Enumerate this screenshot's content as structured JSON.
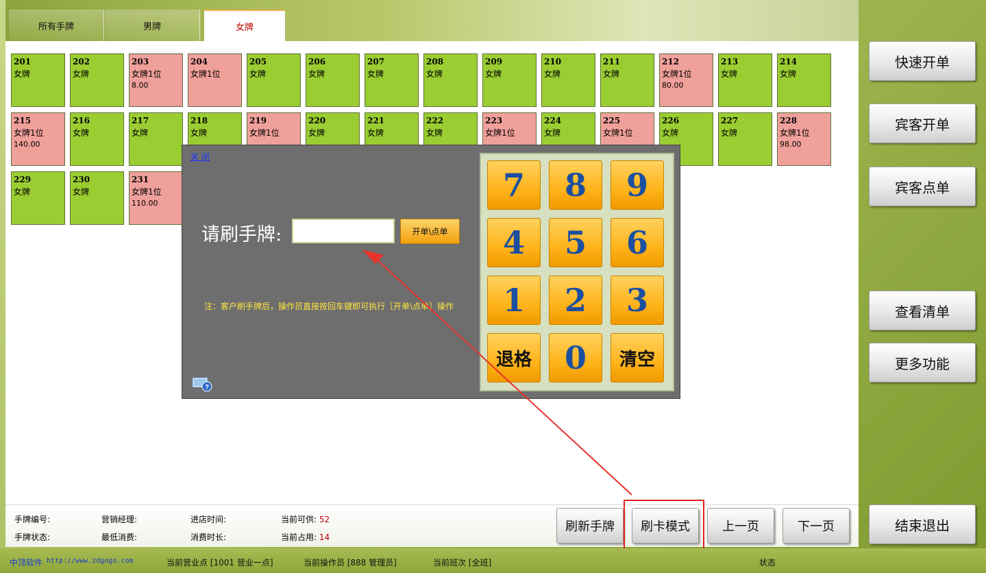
{
  "tabs": [
    {
      "label": "所有手牌",
      "active": false
    },
    {
      "label": "男牌",
      "active": false
    },
    {
      "label": "女牌",
      "active": true
    }
  ],
  "cards": [
    {
      "num": "201",
      "type": "女牌",
      "status": "free"
    },
    {
      "num": "202",
      "type": "女牌",
      "status": "free"
    },
    {
      "num": "203",
      "type": "女牌",
      "status": "used",
      "guests": "1位",
      "amount": "8.00"
    },
    {
      "num": "204",
      "type": "女牌",
      "status": "used",
      "guests": "1位"
    },
    {
      "num": "205",
      "type": "女牌",
      "status": "free"
    },
    {
      "num": "206",
      "type": "女牌",
      "status": "free"
    },
    {
      "num": "207",
      "type": "女牌",
      "status": "free"
    },
    {
      "num": "208",
      "type": "女牌",
      "status": "free"
    },
    {
      "num": "209",
      "type": "女牌",
      "status": "free"
    },
    {
      "num": "210",
      "type": "女牌",
      "status": "free"
    },
    {
      "num": "211",
      "type": "女牌",
      "status": "free"
    },
    {
      "num": "212",
      "type": "女牌",
      "status": "used",
      "guests": "1位",
      "amount": "80.00"
    },
    {
      "num": "213",
      "type": "女牌",
      "status": "free"
    },
    {
      "num": "214",
      "type": "女牌",
      "status": "free"
    },
    {
      "num": "215",
      "type": "女牌",
      "status": "used",
      "guests": "1位",
      "amount": "140.00"
    },
    {
      "num": "216",
      "type": "女牌",
      "status": "free"
    },
    {
      "num": "217",
      "type": "女牌",
      "status": "free"
    },
    {
      "num": "218",
      "type": "女牌",
      "status": "free"
    },
    {
      "num": "219",
      "type": "女牌",
      "status": "used",
      "guests": "1位"
    },
    {
      "num": "220",
      "type": "女牌",
      "status": "free"
    },
    {
      "num": "221",
      "type": "女牌",
      "status": "free"
    },
    {
      "num": "222",
      "type": "女牌",
      "status": "free"
    },
    {
      "num": "223",
      "type": "女牌",
      "status": "used",
      "guests": "1位"
    },
    {
      "num": "224",
      "type": "女牌",
      "status": "free"
    },
    {
      "num": "225",
      "type": "女牌",
      "status": "used",
      "guests": "1位"
    },
    {
      "num": "226",
      "type": "女牌",
      "status": "free"
    },
    {
      "num": "227",
      "type": "女牌",
      "status": "free"
    },
    {
      "num": "228",
      "type": "女牌",
      "status": "used",
      "guests": "1位",
      "amount": "98.00"
    },
    {
      "num": "229",
      "type": "女牌",
      "status": "free"
    },
    {
      "num": "230",
      "type": "女牌",
      "status": "free"
    },
    {
      "num": "231",
      "type": "女牌",
      "status": "used",
      "guests": "1位",
      "amount": "110.00"
    }
  ],
  "dialog": {
    "close_label": "关 闭",
    "prompt": "请刷手牌:",
    "input_value": "",
    "open_button": "开单\\点单",
    "note": "注：客户刷手牌后，操作员直接按回车键即可执行［开单\\点单］操作",
    "keys": [
      "7",
      "8",
      "9",
      "4",
      "5",
      "6",
      "1",
      "2",
      "3",
      "退格",
      "0",
      "清空"
    ]
  },
  "info": {
    "card_no_label": "手牌编号:",
    "card_status_label": "手牌状态:",
    "manager_label": "营销经理:",
    "min_spend_label": "最低消费:",
    "entry_time_label": "进店时间:",
    "duration_label": "消费时长:",
    "available_label": "当前可供:",
    "available_value": "52",
    "occupied_label": "当前占用:",
    "occupied_value": "14"
  },
  "bottom_buttons": {
    "refresh": "刷新手牌",
    "swipe_mode": "刷卡模式",
    "prev": "上一页",
    "next": "下一页"
  },
  "side_buttons": {
    "quick_open": "快速开单",
    "guest_open": "宾客开单",
    "guest_order": "宾客点单",
    "view_list": "查看清单",
    "more": "更多功能",
    "exit": "结束退出"
  },
  "status_bar": {
    "brand": "中顶软件",
    "url": "http://www.zdgogo.com",
    "outlet": "当前营业点 [1001 营业一点]",
    "operator": "当前操作员 [888 管理员]",
    "shift": "当前班次 [全班]",
    "state": "状态"
  },
  "colors": {
    "card_free": "#9acd32",
    "card_used": "#f0a09a",
    "active_tab_text": "#c00000",
    "highlight": "#e02020"
  }
}
